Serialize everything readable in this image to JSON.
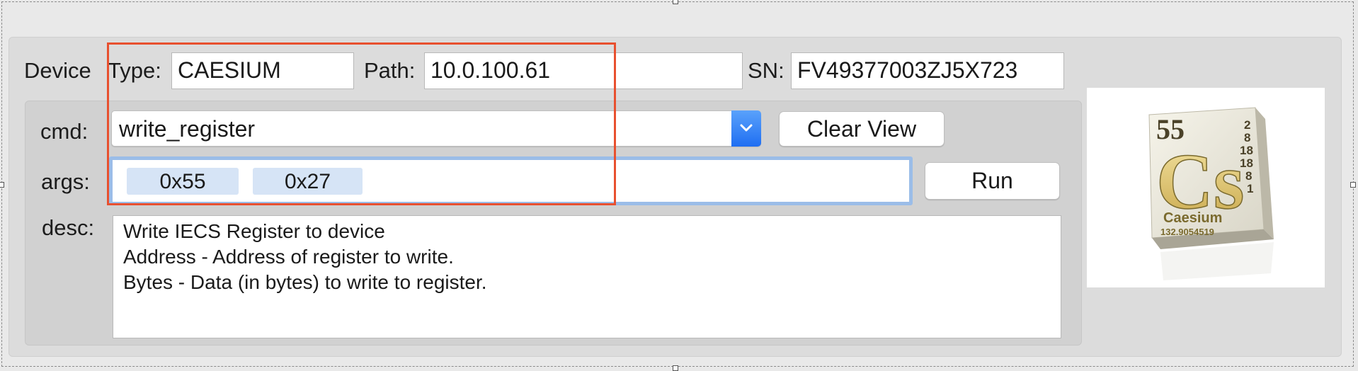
{
  "device": {
    "label": "Device",
    "type_label": "Type:",
    "type_value": "CAESIUM",
    "path_label": "Path:",
    "path_value": "10.0.100.61",
    "sn_label": "SN:",
    "sn_value": "FV49377003ZJ5X723"
  },
  "cmd": {
    "label": "cmd:",
    "value": "write_register",
    "dropdown_icon": "chevron-down-icon"
  },
  "clear_view_label": "Clear View",
  "args": {
    "label": "args:",
    "tokens": [
      "0x55",
      "0x27"
    ]
  },
  "run_label": "Run",
  "desc": {
    "label": "desc:",
    "lines": [
      "Write IECS Register to device",
      "Address - Address of register to write.",
      "Bytes - Data (in bytes) to write to register."
    ]
  },
  "logo": {
    "atomic_number": "55",
    "symbol": "Cs",
    "name": "Caesium",
    "atomic_mass": "132.9054519",
    "shells": [
      "2",
      "8",
      "18",
      "18",
      "8",
      "1"
    ]
  },
  "colors": {
    "highlight": "#e8502f",
    "accent": "#1f6ef2",
    "focus_ring": "#9bbde8"
  }
}
